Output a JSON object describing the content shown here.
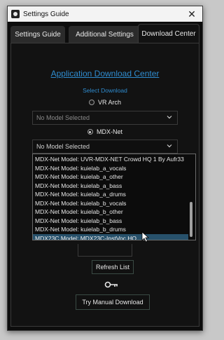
{
  "window": {
    "title": "Settings Guide",
    "close_glyph": "✕"
  },
  "tabs": [
    {
      "label": "Settings Guide"
    },
    {
      "label": "Additional Settings"
    },
    {
      "label": "Download Center"
    }
  ],
  "active_tab_index": 2,
  "main": {
    "title": "Application Download Center",
    "subtitle": "Select Download",
    "vr": {
      "label": "VR Arch",
      "selected": false,
      "combo_value": "No Model Selected"
    },
    "mdx": {
      "label": "MDX-Net",
      "selected": true,
      "combo_value": "No Model Selected"
    },
    "dropdown_items": [
      "MDX-Net Model: UVR-MDX-NET Crowd HQ 1 By Aufr33",
      "MDX-Net Model: kuielab_a_vocals",
      "MDX-Net Model: kuielab_a_other",
      "MDX-Net Model: kuielab_a_bass",
      "MDX-Net Model: kuielab_a_drums",
      "MDX-Net Model: kuielab_b_vocals",
      "MDX-Net Model: kuielab_b_other",
      "MDX-Net Model: kuielab_b_bass",
      "MDX-Net Model: kuielab_b_drums",
      "MDX23C Model: MDX23C-InstVoc HQ"
    ],
    "dropdown_selected_index": 9,
    "refresh_label": "Refresh List",
    "key_icon": "key-icon",
    "manual_download_label": "Try Manual Download"
  },
  "colors": {
    "accent": "#2f8ccf",
    "background": "#121212",
    "selection": "#27516b"
  }
}
